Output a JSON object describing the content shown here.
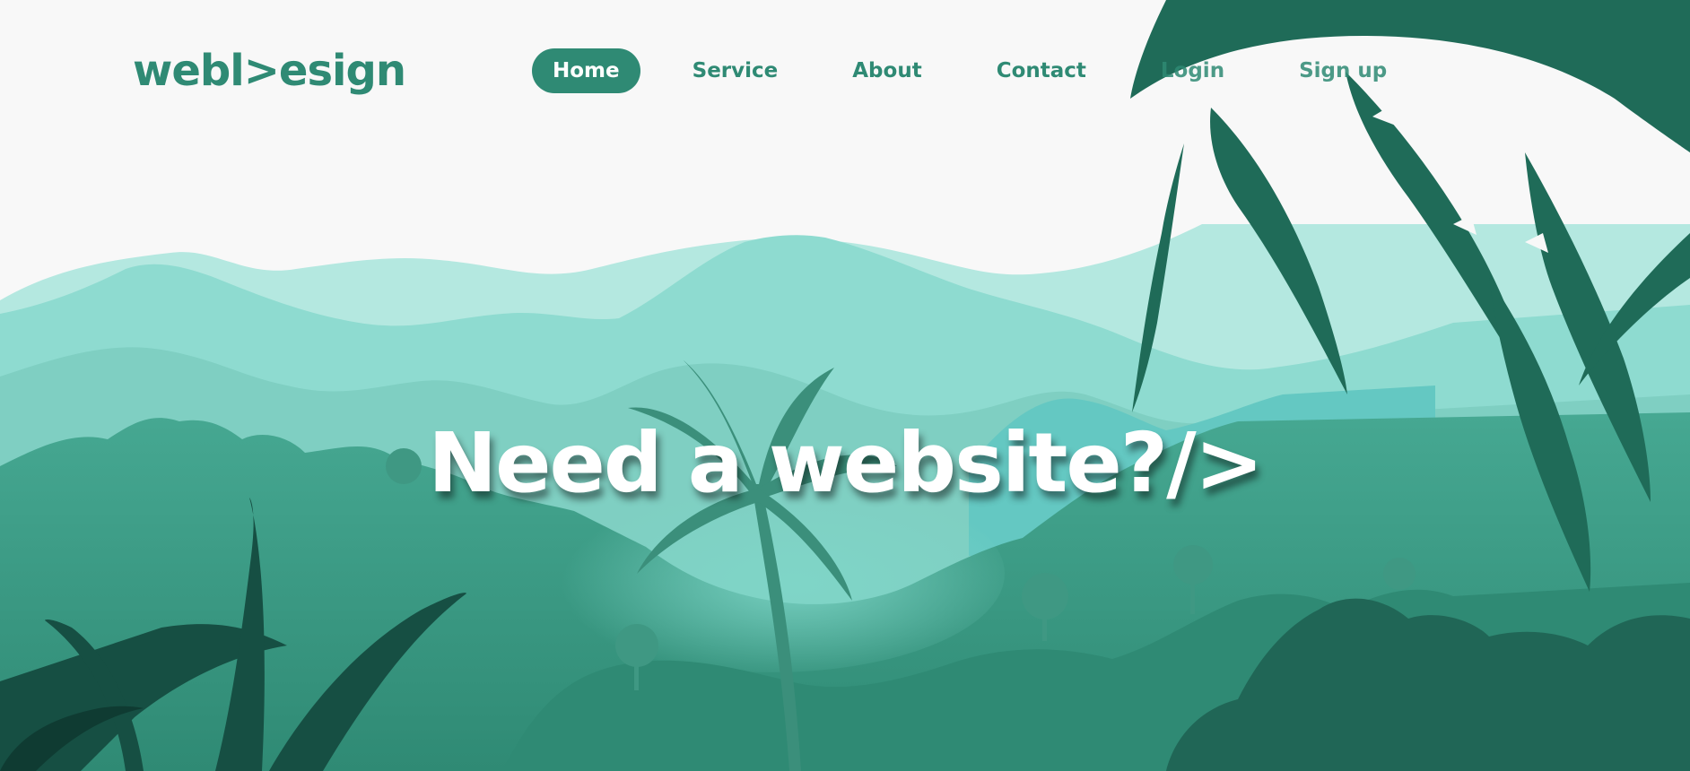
{
  "brand": {
    "logo_text": "webl>esign"
  },
  "nav": {
    "items": [
      {
        "label": "Home",
        "active": true
      },
      {
        "label": "Service"
      },
      {
        "label": "About"
      },
      {
        "label": "Contact"
      },
      {
        "label": "Login"
      },
      {
        "label": "Sign up"
      }
    ]
  },
  "hero": {
    "headline": "Need a website?/>"
  },
  "colors": {
    "background": "#f8f8f8",
    "accent": "#2f8a74",
    "mountain_far": "#b4e8e0",
    "mountain_mid": "#8edbd0",
    "forest": "#3f9f89",
    "foliage_dark": "#1f6b58"
  }
}
